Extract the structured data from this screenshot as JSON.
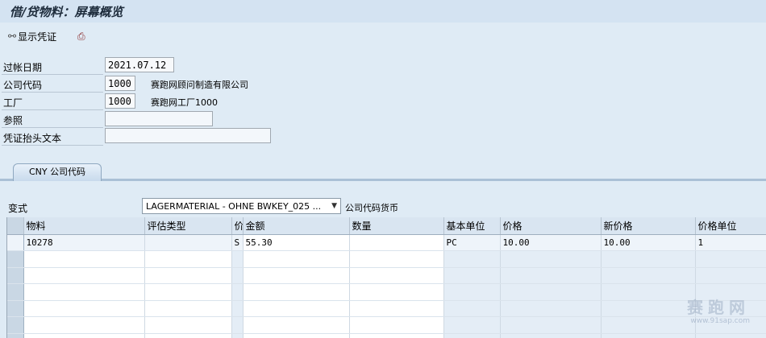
{
  "window": {
    "title": "借/贷物料：屏幕概览"
  },
  "toolbar": {
    "show_doc_label": "显示凭证",
    "show_doc_icon": "glasses-icon",
    "print_icon": "printer-icon"
  },
  "fields": {
    "posting_date": {
      "label": "过帐日期",
      "value": "2021.07.12"
    },
    "company_code": {
      "label": "公司代码",
      "value": "1000",
      "desc": "赛跑网顾问制造有限公司"
    },
    "plant": {
      "label": "工厂",
      "value": "1000",
      "desc": "赛跑网工厂1000"
    },
    "reference": {
      "label": "参照",
      "value": ""
    },
    "header_text": {
      "label": "凭证抬头文本",
      "value": ""
    }
  },
  "tab": {
    "label": "CNY 公司代码"
  },
  "variant": {
    "label": "变式",
    "selected": "LAGERMATERIAL - OHNE BWKEY_025 ...",
    "note": "公司代码货币"
  },
  "table": {
    "columns": [
      "物料",
      "评估类型",
      "价",
      "金额",
      "数量",
      "基本单位",
      "价格",
      "新价格",
      "价格单位"
    ],
    "rows": [
      [
        "10278",
        "",
        "S",
        "55.30",
        "",
        "PC",
        "10.00",
        "10.00",
        "1"
      ]
    ]
  },
  "watermark": {
    "text": "赛跑网",
    "sub": "www.91sap.com"
  }
}
